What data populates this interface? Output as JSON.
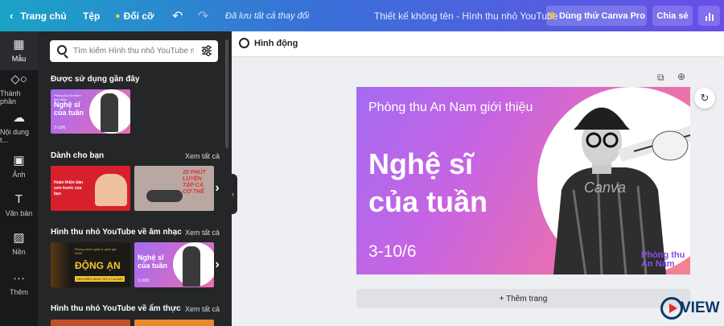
{
  "topbar": {
    "home": "Trang chủ",
    "file": "Tệp",
    "resize": "Đổi cỡ",
    "saved_status": "Đã lưu tất cả thay đổi",
    "doc_title": "Thiết kế không tên - Hình thu nhỏ YouTube",
    "try_pro": "Dùng thử Canva Pro",
    "share": "Chia sẻ"
  },
  "rail": [
    {
      "label": "Mẫu",
      "icon": "template-icon"
    },
    {
      "label": "Thành phần",
      "icon": "elements-icon"
    },
    {
      "label": "Nội dung t...",
      "icon": "upload-icon"
    },
    {
      "label": "Ảnh",
      "icon": "photo-icon"
    },
    {
      "label": "Văn bản",
      "icon": "text-icon"
    },
    {
      "label": "Nền",
      "icon": "background-icon"
    },
    {
      "label": "Thêm",
      "icon": "more-icon"
    }
  ],
  "search": {
    "placeholder": "Tìm kiếm Hình thu nhỏ YouTube mẫu"
  },
  "sections": {
    "recent": "Được sử dụng gần đây",
    "for_you": "Dành cho bạn",
    "music": "Hình thu nhỏ YouTube về âm nhạc",
    "food": "Hình thu nhỏ YouTube về ẩm thực",
    "see_all": "Xem tất cả"
  },
  "thumbs": {
    "recent_text": "Nghệ sĩ của tuần",
    "recent_small": "Phòng thu An Nam giới thiệu",
    "recent_date": "3-10/6",
    "foryou1_text": "Hoàn thiện bản sơn trước của bạn",
    "foryou2_text": "20 PHÚT LUYỆN TẬP CẢ CƠ THỂ",
    "music1_text": "ĐỘNG ẠN",
    "music1_small": "Phong cách nghệ sĩ quốc gia 2020",
    "music1_tag": "XEM ĐIỆU NHẢY SỐ 5 TẠI ĐÂY",
    "music2_text": "Nghệ sĩ của tuần",
    "music2_date": "3-10/6"
  },
  "editor": {
    "animate": "Hình động",
    "add_page": "+ Thêm trang"
  },
  "canvas": {
    "subtitle": "Phòng thu An Nam giới thiệu",
    "headline": "Nghệ sĩ của tuần",
    "date": "3-10/6",
    "brand": "Phòng thu An Nam",
    "watermark": "Canva"
  },
  "watermark_logo": "VIEW",
  "colors": {
    "accent": "#7d2ae8",
    "topbar_start": "#1ba3c6",
    "topbar_end": "#6a4ee8"
  }
}
